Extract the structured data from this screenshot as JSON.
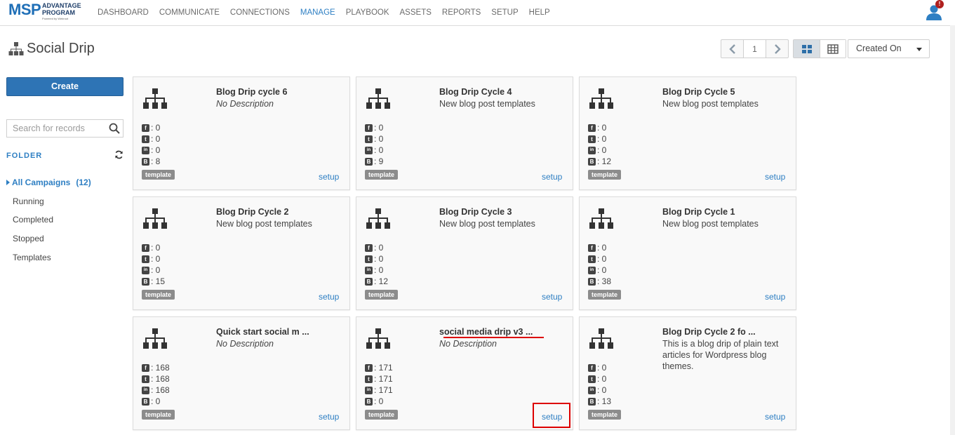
{
  "logo": {
    "brand": "MSP",
    "line1": "ADVANTAGE",
    "line2": "PROGRAM",
    "powered": "Powered by Webroot"
  },
  "nav": [
    "DASHBOARD",
    "COMMUNICATE",
    "CONNECTIONS",
    "MANAGE",
    "PLAYBOOK",
    "ASSETS",
    "REPORTS",
    "SETUP",
    "HELP"
  ],
  "nav_active": "MANAGE",
  "user": {
    "badge": "!"
  },
  "header": {
    "title": "Social Drip",
    "page": "1",
    "sort": "Created On"
  },
  "sidebar": {
    "create_label": "Create",
    "search_placeholder": "Search for records",
    "folder_label": "FOLDER",
    "all_label": "All Campaigns",
    "all_count": "(12)",
    "items": [
      "Running",
      "Completed",
      "Stopped",
      "Templates"
    ]
  },
  "cards": [
    {
      "name": "Blog Drip cycle 6",
      "desc": "No Description",
      "italic": true,
      "fb": "0",
      "tw": "0",
      "li": "0",
      "bl": "8",
      "tag": "template",
      "setup": "setup"
    },
    {
      "name": "Blog Drip Cycle 4",
      "desc": "New blog post templates",
      "italic": false,
      "fb": "0",
      "tw": "0",
      "li": "0",
      "bl": "9",
      "tag": "template",
      "setup": "setup"
    },
    {
      "name": "Blog Drip Cycle 5",
      "desc": "New blog post templates",
      "italic": false,
      "fb": "0",
      "tw": "0",
      "li": "0",
      "bl": "12",
      "tag": "template",
      "setup": "setup"
    },
    {
      "name": "Blog Drip Cycle 2",
      "desc": "New blog post templates",
      "italic": false,
      "fb": "0",
      "tw": "0",
      "li": "0",
      "bl": "15",
      "tag": "template",
      "setup": "setup"
    },
    {
      "name": "Blog Drip Cycle 3",
      "desc": "New blog post templates",
      "italic": false,
      "fb": "0",
      "tw": "0",
      "li": "0",
      "bl": "12",
      "tag": "template",
      "setup": "setup"
    },
    {
      "name": "Blog Drip Cycle 1",
      "desc": "New blog post templates",
      "italic": false,
      "fb": "0",
      "tw": "0",
      "li": "0",
      "bl": "38",
      "tag": "template",
      "setup": "setup"
    },
    {
      "name": "Quick start social m ...",
      "desc": "No Description",
      "italic": true,
      "fb": "168",
      "tw": "168",
      "li": "168",
      "bl": "0",
      "tag": "template",
      "setup": "setup"
    },
    {
      "name": "social media drip v3 ...",
      "desc": "No Description",
      "italic": true,
      "fb": "171",
      "tw": "171",
      "li": "171",
      "bl": "0",
      "tag": "template",
      "setup": "setup"
    },
    {
      "name": "Blog Drip Cycle 2 fo ...",
      "desc": "This is a blog drip of plain text articles for Wordpress blog themes.",
      "italic": false,
      "fb": "0",
      "tw": "0",
      "li": "0",
      "bl": "13",
      "tag": "template",
      "setup": "setup"
    }
  ],
  "colors": {
    "accent": "#2e7fc3",
    "primary_button": "#2e74b5",
    "annotation": "#dd0000"
  }
}
